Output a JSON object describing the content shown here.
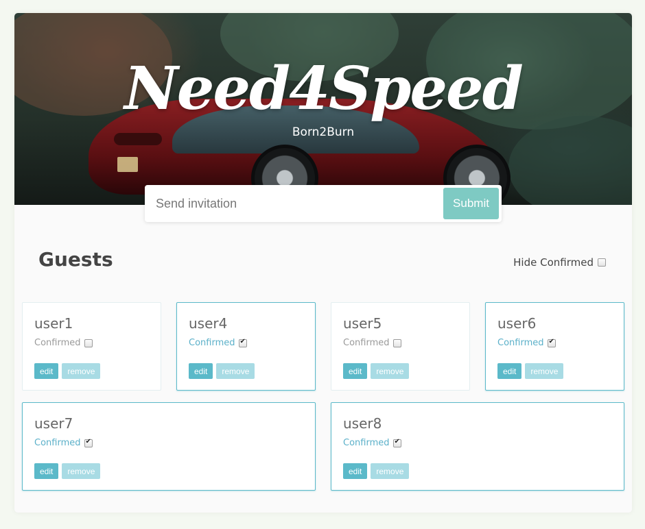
{
  "header": {
    "title": "Need4Speed",
    "subtitle": "Born2Burn"
  },
  "invite": {
    "placeholder": "Send invitation",
    "value": "",
    "submit_label": "Submit"
  },
  "guests_section": {
    "title": "Guests",
    "hide_confirmed_label": "Hide Confirmed",
    "hide_confirmed_checked": false
  },
  "guests": [
    {
      "name": "user1",
      "status_label": "Confirmed",
      "confirmed": false,
      "edit_label": "edit",
      "remove_label": "remove"
    },
    {
      "name": "user4",
      "status_label": "Confirmed",
      "confirmed": true,
      "edit_label": "edit",
      "remove_label": "remove"
    },
    {
      "name": "user5",
      "status_label": "Confirmed",
      "confirmed": false,
      "edit_label": "edit",
      "remove_label": "remove"
    },
    {
      "name": "user6",
      "status_label": "Confirmed",
      "confirmed": true,
      "edit_label": "edit",
      "remove_label": "remove"
    },
    {
      "name": "user7",
      "status_label": "Confirmed",
      "confirmed": true,
      "edit_label": "edit",
      "remove_label": "remove"
    },
    {
      "name": "user8",
      "status_label": "Confirmed",
      "confirmed": true,
      "edit_label": "edit",
      "remove_label": "remove"
    }
  ],
  "colors": {
    "accent": "#5bb9c9",
    "submit": "#7ecac3",
    "remove": "#a8dbe4",
    "page_background": "#f4f8f1"
  }
}
